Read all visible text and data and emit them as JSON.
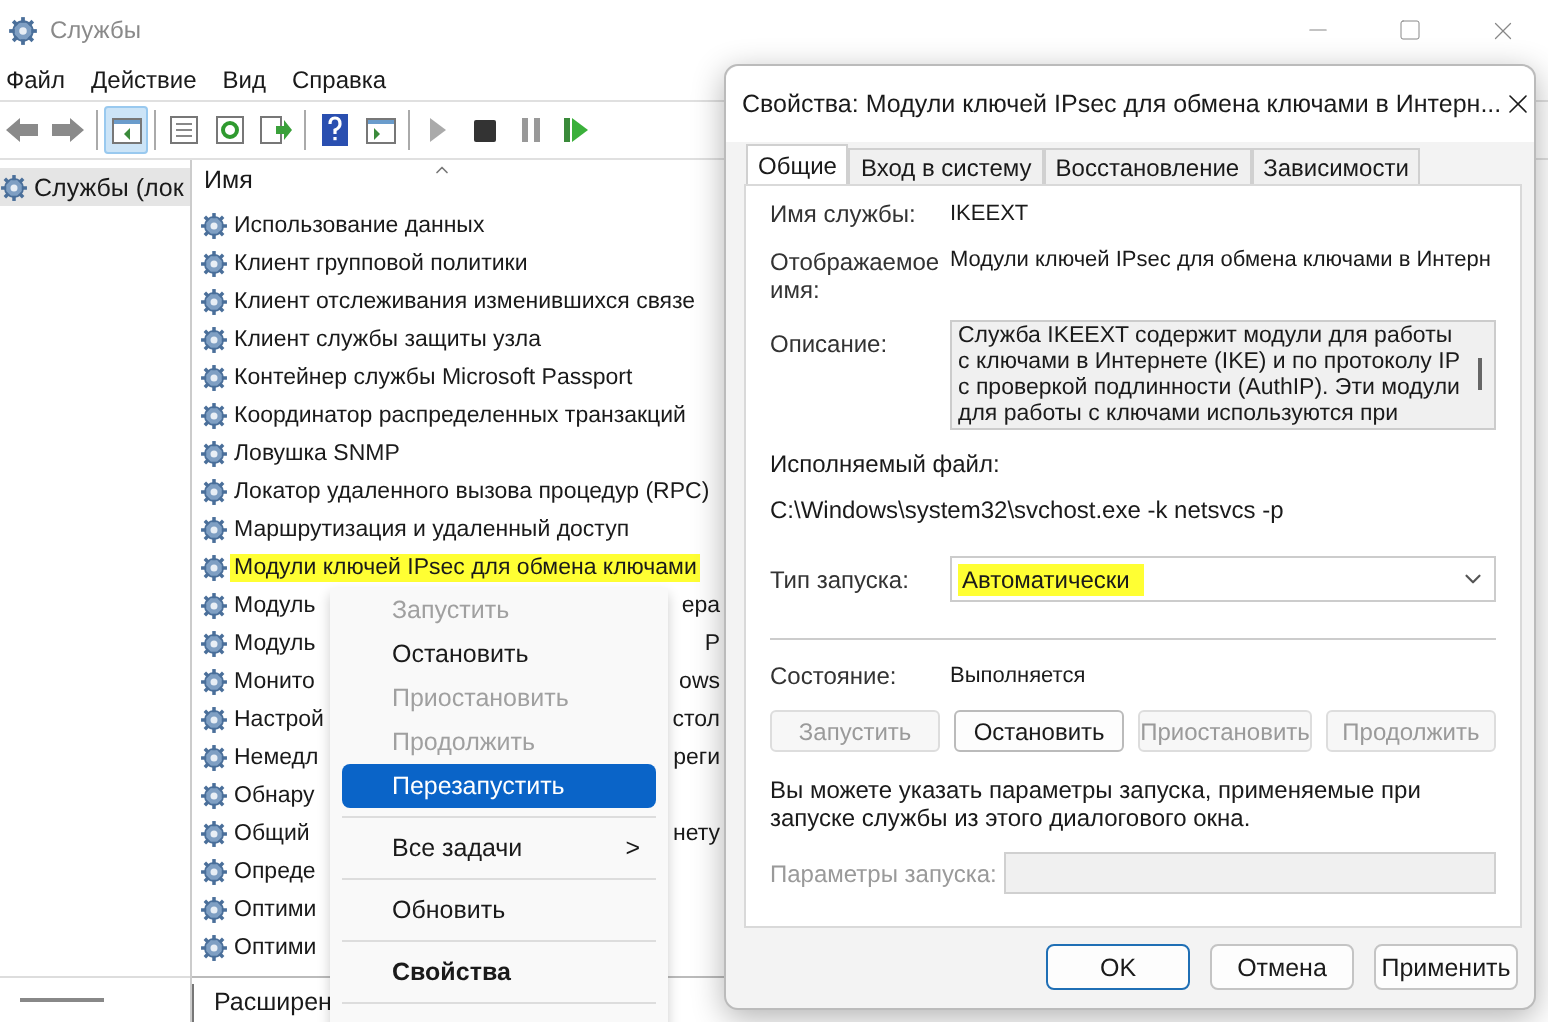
{
  "window": {
    "title": "Службы"
  },
  "menu": [
    "Файл",
    "Действие",
    "Вид",
    "Справка"
  ],
  "toolbar": [
    {
      "kind": "back",
      "selected": false
    },
    {
      "kind": "forward",
      "selected": false
    },
    {
      "kind": "sep"
    },
    {
      "kind": "tree",
      "selected": true
    },
    {
      "kind": "sep"
    },
    {
      "kind": "list",
      "selected": false
    },
    {
      "kind": "refresh",
      "selected": false
    },
    {
      "kind": "export",
      "selected": false
    },
    {
      "kind": "sep"
    },
    {
      "kind": "help",
      "selected": false
    },
    {
      "kind": "panel",
      "selected": false
    },
    {
      "kind": "sep"
    },
    {
      "kind": "play",
      "selected": false
    },
    {
      "kind": "stop",
      "selected": false
    },
    {
      "kind": "pause",
      "selected": false
    },
    {
      "kind": "restart",
      "selected": false
    }
  ],
  "tree": [
    {
      "label": "Службы (лок",
      "selected": true
    }
  ],
  "list": {
    "column": "Имя",
    "rows": [
      {
        "name": "Использование данных",
        "highlighted": false
      },
      {
        "name": "Клиент групповой политики",
        "highlighted": false
      },
      {
        "name": "Клиент отслеживания изменившихся связе",
        "highlighted": false
      },
      {
        "name": "Клиент службы защиты узла",
        "highlighted": false
      },
      {
        "name": "Контейнер службы Microsoft Passport",
        "highlighted": false
      },
      {
        "name": "Координатор распределенных транзакций",
        "highlighted": false
      },
      {
        "name": "Ловушка SNMP",
        "highlighted": false
      },
      {
        "name": "Локатор удаленного вызова процедур (RPC)",
        "highlighted": false
      },
      {
        "name": "Маршрутизация и удаленный доступ",
        "highlighted": false
      },
      {
        "name": "Модули ключей IPsec для обмена ключами",
        "highlighted": true
      },
      {
        "name": "Модуль",
        "name_end": "ера",
        "highlighted": false
      },
      {
        "name": "Модуль",
        "name_end": "P",
        "highlighted": false
      },
      {
        "name": "Монито",
        "name_end": "ows",
        "highlighted": false
      },
      {
        "name": "Настрой",
        "name_end": "стол",
        "highlighted": false
      },
      {
        "name": "Немедл",
        "name_end": "реги",
        "highlighted": false
      },
      {
        "name": "Обнару",
        "highlighted": false
      },
      {
        "name": "Общий",
        "name_end": "нету",
        "highlighted": false
      },
      {
        "name": "Опреде",
        "highlighted": false
      },
      {
        "name": "Оптими",
        "highlighted": false
      },
      {
        "name": "Оптими",
        "highlighted": false
      }
    ]
  },
  "bottom_tabs": [
    {
      "label": "Расширен",
      "selected": true
    }
  ],
  "context_menu": [
    {
      "kind": "item",
      "label": "Запустить",
      "disabled": true,
      "selected": false
    },
    {
      "kind": "item",
      "label": "Остановить",
      "disabled": false,
      "selected": false
    },
    {
      "kind": "item",
      "label": "Приостановить",
      "disabled": true,
      "selected": false
    },
    {
      "kind": "item",
      "label": "Продолжить",
      "disabled": true,
      "selected": false
    },
    {
      "kind": "item",
      "label": "Перезапустить",
      "disabled": false,
      "selected": true
    },
    {
      "kind": "separator"
    },
    {
      "kind": "submenu",
      "label": "Все задачи",
      "disabled": false,
      "selected": false,
      "arrow": ">"
    },
    {
      "kind": "separator"
    },
    {
      "kind": "item",
      "label": "Обновить",
      "disabled": false,
      "selected": false
    },
    {
      "kind": "separator"
    },
    {
      "kind": "item",
      "label": "Свойства",
      "disabled": false,
      "selected": false,
      "default": true
    },
    {
      "kind": "separator"
    }
  ],
  "dialog": {
    "title": "Свойства: Модули ключей IPsec для обмена ключами в Интерн...",
    "tabs": [
      {
        "label": "Общие",
        "selected": true
      },
      {
        "label": "Вход в систему",
        "selected": false
      },
      {
        "label": "Восстановление",
        "selected": false
      },
      {
        "label": "Зависимости",
        "selected": false
      }
    ],
    "service_name": {
      "label": "Имя службы:",
      "value": "IKEEXT"
    },
    "display_name": {
      "label": "Отображаемое имя:",
      "value": "Модули ключей IPsec для обмена ключами в Интерн"
    },
    "description": {
      "label": "Описание:",
      "value": "Служба IKEEXT содержит модули для работы с ключами в Интернете (IKE) и по протоколу IP с проверкой подлинности (AuthIP). Эти модули для работы с ключами используются при"
    },
    "executable": {
      "label": "Исполняемый файл:",
      "value": "C:\\Windows\\system32\\svchost.exe -k netsvcs -p"
    },
    "startup_type": {
      "label": "Тип запуска:",
      "value": "Автоматически",
      "highlighted": true
    },
    "status": {
      "label": "Состояние:",
      "value": "Выполняется"
    },
    "service_buttons": [
      {
        "label": "Запустить",
        "disabled": true
      },
      {
        "label": "Остановить",
        "disabled": false
      },
      {
        "label": "Приостановить",
        "disabled": true
      },
      {
        "label": "Продолжить",
        "disabled": true
      }
    ],
    "hint": "Вы можете указать параметры запуска, применяемые при запуске службы из этого диалогового окна.",
    "parameters": {
      "label": "Параметры запуска:",
      "disabled": true
    },
    "footer_buttons": [
      {
        "label": "OK",
        "default": true
      },
      {
        "label": "Отмена",
        "default": false
      },
      {
        "label": "Применить",
        "default": false
      }
    ]
  }
}
